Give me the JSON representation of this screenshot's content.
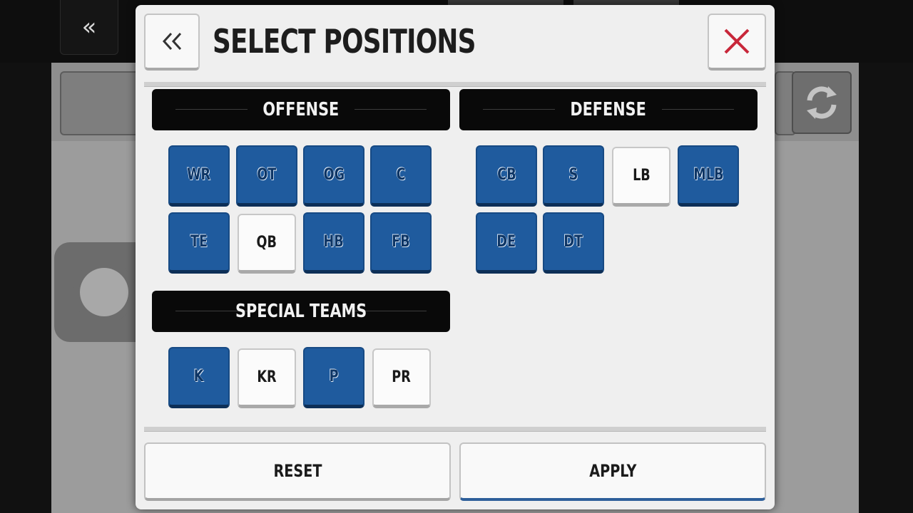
{
  "background": {
    "back_icon": "double-chevron-left-icon",
    "refresh_icon": "refresh-icon"
  },
  "modal": {
    "title": "SELECT POSITIONS",
    "back_icon": "double-chevron-left-icon",
    "close_icon": "close-x-icon",
    "close_color": "#c8273a",
    "accent_color": "#1f5b9e"
  },
  "offense": {
    "label": "OFFENSE",
    "positions": [
      {
        "code": "WR",
        "selected": true
      },
      {
        "code": "OT",
        "selected": true
      },
      {
        "code": "OG",
        "selected": true
      },
      {
        "code": "C",
        "selected": true
      },
      {
        "code": "TE",
        "selected": true
      },
      {
        "code": "QB",
        "selected": false
      },
      {
        "code": "HB",
        "selected": true
      },
      {
        "code": "FB",
        "selected": true
      }
    ]
  },
  "defense": {
    "label": "DEFENSE",
    "positions": [
      {
        "code": "CB",
        "selected": true
      },
      {
        "code": "S",
        "selected": true
      },
      {
        "code": "LB",
        "selected": false
      },
      {
        "code": "MLB",
        "selected": true
      },
      {
        "code": "DE",
        "selected": true
      },
      {
        "code": "DT",
        "selected": true
      }
    ]
  },
  "special_teams": {
    "label": "SPECIAL TEAMS",
    "positions": [
      {
        "code": "K",
        "selected": true
      },
      {
        "code": "KR",
        "selected": false
      },
      {
        "code": "P",
        "selected": true
      },
      {
        "code": "PR",
        "selected": false
      }
    ]
  },
  "footer": {
    "reset_label": "RESET",
    "apply_label": "APPLY"
  }
}
